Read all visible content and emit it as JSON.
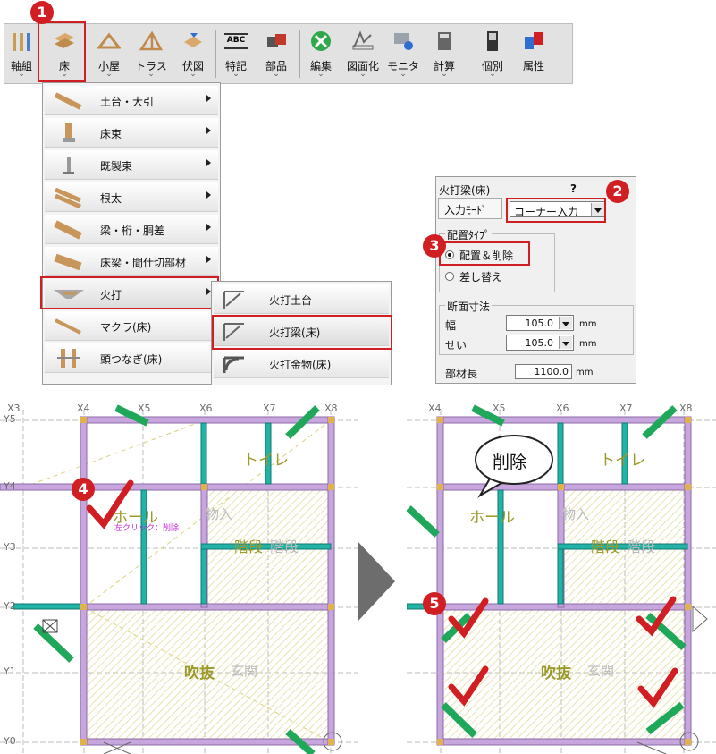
{
  "toolbar": {
    "items": [
      {
        "label": "軸組",
        "icon": "frame-icon"
      },
      {
        "label": "床",
        "icon": "floor-icon"
      },
      {
        "label": "小屋",
        "icon": "roof-frame-icon"
      },
      {
        "label": "トラス",
        "icon": "truss-icon"
      },
      {
        "label": "伏図",
        "icon": "plan-icon"
      },
      {
        "label": "特記",
        "icon": "note-icon",
        "badge_text": "ABC"
      },
      {
        "label": "部品",
        "icon": "parts-icon"
      },
      {
        "label": "編集",
        "icon": "edit-icon"
      },
      {
        "label": "図面化",
        "icon": "drawing-icon"
      },
      {
        "label": "モニタ",
        "icon": "monitor-icon"
      },
      {
        "label": "計算",
        "icon": "calc-icon"
      },
      {
        "label": "個別",
        "icon": "individual-icon"
      },
      {
        "label": "属性",
        "icon": "attribute-icon"
      }
    ],
    "chevron": "⌄"
  },
  "floor_menu": {
    "items": [
      {
        "label": "土台・大引",
        "has_submenu": true
      },
      {
        "label": "床束",
        "has_submenu": true
      },
      {
        "label": "既製束",
        "has_submenu": true
      },
      {
        "label": "根太",
        "has_submenu": true
      },
      {
        "label": "梁・桁・胴差",
        "has_submenu": true
      },
      {
        "label": "床梁・間仕切部材",
        "has_submenu": true
      },
      {
        "label": "火打",
        "has_submenu": true,
        "highlighted": true
      },
      {
        "label": "マクラ(床)",
        "has_submenu": false
      },
      {
        "label": "頭つなぎ(床)",
        "has_submenu": false
      }
    ]
  },
  "hiuchi_submenu": {
    "items": [
      {
        "label": "火打土台"
      },
      {
        "label": "火打梁(床)",
        "highlighted": true
      },
      {
        "label": "火打金物(床)"
      }
    ]
  },
  "dialog": {
    "title": "火打梁(床)",
    "help": "?",
    "input_mode_label": "入力ﾓｰﾄﾞ",
    "input_mode_value": "コーナー入力",
    "placement_group": "配置ﾀｲﾌﾟ",
    "radio_place_delete": "配置＆削除",
    "radio_replace": "差し替え",
    "section_group": "断面寸法",
    "width_label": "幅",
    "width_value": "105.0",
    "height_label": "せい",
    "height_value": "105.0",
    "length_label": "部材長",
    "length_value": "1100.0",
    "unit": "mm"
  },
  "badges": [
    "1",
    "2",
    "3",
    "4",
    "5"
  ],
  "plan_left": {
    "grid_x": [
      "X3",
      "X4",
      "X5",
      "X6",
      "X7",
      "X8"
    ],
    "grid_y": [
      "Y5",
      "Y4",
      "Y3",
      "Y2",
      "Y1",
      "Y0"
    ],
    "rooms": [
      "トイレ",
      "ホール",
      "物入",
      "階段",
      "階段",
      "吹抜",
      "玄関"
    ],
    "hint": "左クリック：削除"
  },
  "plan_right": {
    "grid_x": [
      "X4",
      "X5",
      "X6",
      "X7",
      "X8"
    ],
    "rooms": [
      "トイレ",
      "ホール",
      "物入",
      "階段",
      "階段",
      "吹抜",
      "玄関"
    ],
    "callout": "削除"
  },
  "colors": {
    "accent_red": "#d11e22",
    "beam_purple": "#c6a6dc",
    "brace_green": "#1fa85a",
    "joist_teal": "#22b3a6",
    "room_text": "#9b9a2a"
  }
}
